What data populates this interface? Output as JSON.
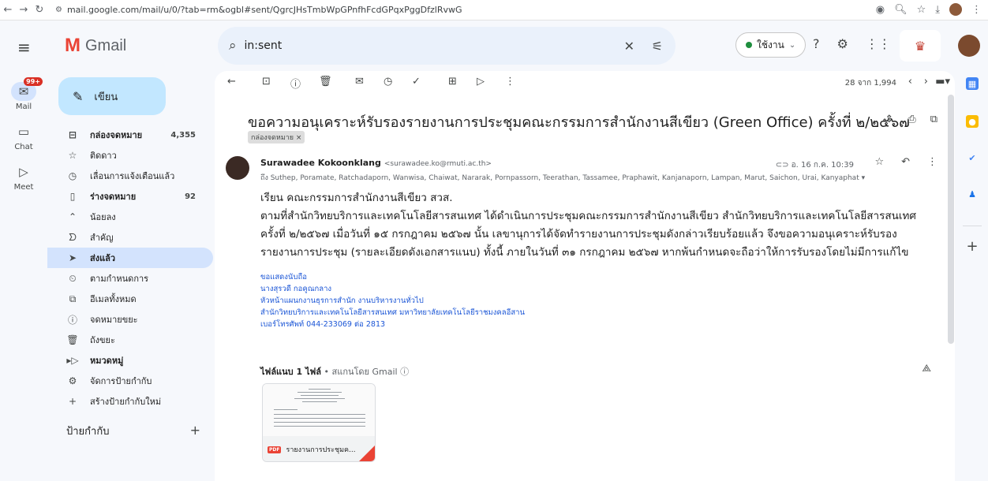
{
  "browser": {
    "url": "mail.google.com/mail/u/0/?tab=rm&ogbl#sent/QgrcJHsTmbWpGPnfhFcdGPqxPggDfzlRvwG"
  },
  "app": {
    "name": "Gmail",
    "search_query": "in:sent",
    "status_label": "ใช้งาน"
  },
  "rail": [
    {
      "label": "Mail",
      "badge": "99+"
    },
    {
      "label": "Chat"
    },
    {
      "label": "Meet"
    }
  ],
  "sidebar": {
    "compose_label": "เขียน",
    "items": [
      {
        "label": "กล่องจดหมาย",
        "count": "4,355",
        "bold": true,
        "icon": "inbox-icon"
      },
      {
        "label": "ติดดาว",
        "count": "",
        "icon": "star-icon"
      },
      {
        "label": "เลื่อนการแจ้งเตือนแล้ว",
        "count": "",
        "icon": "clock-icon"
      },
      {
        "label": "ร่างจดหมาย",
        "count": "92",
        "bold": true,
        "icon": "draft-icon"
      },
      {
        "label": "น้อยลง",
        "count": "",
        "icon": "chevron-up-icon"
      },
      {
        "label": "สำคัญ",
        "count": "",
        "icon": "important-icon"
      },
      {
        "label": "ส่งแล้ว",
        "count": "",
        "active": true,
        "icon": "send-icon"
      },
      {
        "label": "ตามกำหนดการ",
        "count": "",
        "icon": "scheduled-icon"
      },
      {
        "label": "อีเมลทั้งหมด",
        "count": "",
        "icon": "all-mail-icon"
      },
      {
        "label": "จดหมายขยะ",
        "count": "",
        "icon": "spam-icon"
      },
      {
        "label": "ถังขยะ",
        "count": "",
        "icon": "trash-icon"
      },
      {
        "label": "หมวดหมู่",
        "count": "",
        "bold": true,
        "icon": "category-icon"
      },
      {
        "label": "จัดการป้ายกำกับ",
        "count": "",
        "icon": "gear-icon"
      },
      {
        "label": "สร้างป้ายกำกับใหม่",
        "count": "",
        "icon": "plus-icon"
      }
    ],
    "labels_heading": "ป้ายกำกับ"
  },
  "toolbar": {
    "pager_text": "28 จาก 1,994"
  },
  "message": {
    "subject": "ขอความอนุเคราะห์รับรองรายงานการประชุมคณะกรรมการสำนักงานสีเขียว (Green Office) ครั้งที่ ๒/๒๕๖๗",
    "label_chip": "กล่องจดหมาย ×",
    "sender_name": "Surawadee Kokoonklang",
    "sender_email": "<surawadee.ko@rmuti.ac.th>",
    "to_line": "ถึง Suthep, Poramate, Ratchadaporn, Wanwisa, Chaiwat, Nararak, Pornpassorn, Teerathan, Tassamee, Praphawit, Kanjanaporn, Lampan, Marut, Saichon, Urai, Kanyaphat ▾",
    "date": "อ. 16 ก.ค. 10:39",
    "body_lines": [
      "เรียน คณะกรรมการสำนักงานสีเขียว สวส.",
      "ตามที่สำนักวิทยบริการและเทคโนโลยีสารสนเทศ ได้ดำเนินการประชุมคณะกรรมการสำนักงานสีเขียว สำนักวิทยบริการและเทคโนโลยีสารสนเทศ",
      "ครั้งที่ ๒/๒๕๖๗ เมื่อวันที่ ๑๕ กรกฎาคม ๒๕๖๗ นั้น เลขานุการได้จัดทำรายงานการประชุมดังกล่าวเรียบร้อยแล้ว จึงขอความอนุเคราะห์รับรอง",
      "รายงานการประชุม (รายละเอียดดังเอกสารแนบ) ทั้งนี้ ภายในวันที่ ๓๑ กรกฎาคม ๒๕๖๗ หากพ้นกำหนดจะถือว่าให้การรับรองโดยไม่มีการแก้ไข"
    ],
    "signature_lines": [
      "ขอแสดงนับถือ",
      "นางสุรวดี  กอคูณกลาง",
      "หัวหน้าแผนกงานธุรการสำนัก งานบริหารงานทั่วไป",
      "สำนักวิทยบริการและเทคโนโลยีสารสนเทศ มหาวิทยาลัยเทคโนโลยีราชมงคลอีสาน",
      "เบอร์โทรศัพท์ 044-233069 ต่อ 2813"
    ],
    "attachments_heading": "ไฟล์แนบ 1 ไฟล์",
    "attachments_scanned": " • สแกนโดย Gmail ⓘ",
    "attachment": {
      "type": "PDF",
      "name": "รายงานการประชุมค..."
    }
  }
}
